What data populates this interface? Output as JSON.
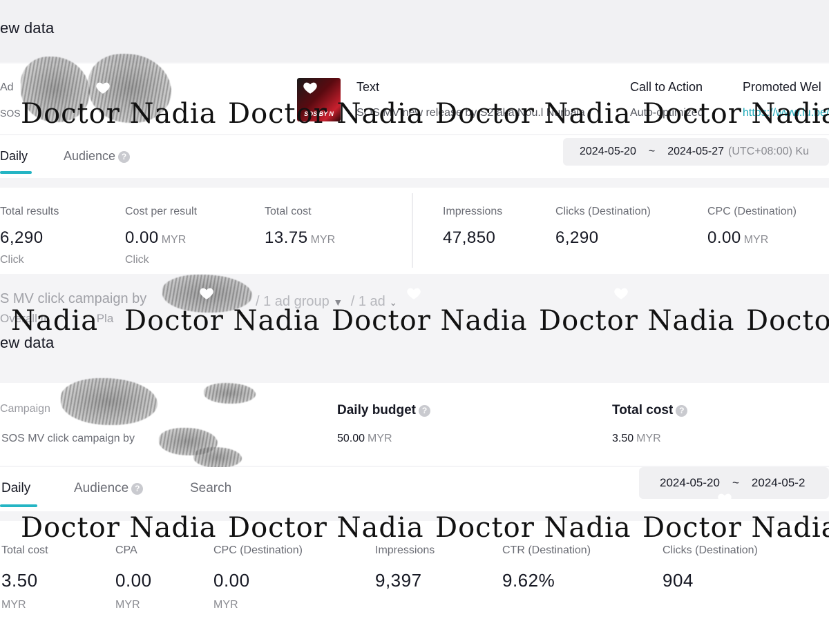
{
  "top": {
    "title": "ew data",
    "ad": {
      "label": "Ad",
      "name_preview": "SOS",
      "text_header": "Text",
      "text_value": "SOS MV new release by S2 aka Nou.l Nurbaia",
      "cta_header": "Call to Action",
      "cta_value": "Auto-optimized",
      "site_header": "Promoted Wel",
      "site_value": "https://www.lu.be/"
    },
    "thumbnail_text": "SOS BY N",
    "tabs": [
      "Daily",
      "Audience"
    ],
    "date_range": {
      "start": "2024-05-20",
      "sep": "~",
      "end": "2024-05-27",
      "tz": "(UTC+08:00) Ku"
    },
    "metrics": [
      {
        "label": "Total results",
        "value": "6,290",
        "unit": "",
        "sub": "Click"
      },
      {
        "label": "Cost per result",
        "value": "0.00",
        "unit": "MYR",
        "sub": "Click"
      },
      {
        "label": "Total cost",
        "value": "13.75",
        "unit": "MYR",
        "sub": ""
      },
      {
        "label": "Impressions",
        "value": "47,850",
        "unit": "",
        "sub": ""
      },
      {
        "label": "Clicks (Destination)",
        "value": "6,290",
        "unit": "",
        "sub": ""
      },
      {
        "label": "CPC (Destination)",
        "value": "0.00",
        "unit": "MYR",
        "sub": ""
      }
    ]
  },
  "breadcrumb": {
    "campaign": "S MV click campaign by",
    "ad_group": "/ 1 ad group",
    "ad": "/ 1 ad",
    "sub1": "Overall tr",
    "sub2": "Pla"
  },
  "bottom": {
    "title": "ew data",
    "campaign_label": "Campaign",
    "campaign_value": "SOS MV click campaign by",
    "budget_label": "Daily budget",
    "budget_value": "50.00",
    "budget_unit": "MYR",
    "cost_label": "Total cost",
    "cost_value": "3.50",
    "cost_unit": "MYR",
    "tabs": [
      "Daily",
      "Audience",
      "Search"
    ],
    "date_range": {
      "start": "2024-05-20",
      "sep": "~",
      "end": "2024-05-2"
    },
    "metrics": [
      {
        "label": "Total cost",
        "value": "3.50",
        "sub": "MYR"
      },
      {
        "label": "CPA",
        "value": "0.00",
        "sub": "MYR"
      },
      {
        "label": "CPC (Destination)",
        "value": "0.00",
        "sub": "MYR"
      },
      {
        "label": "Impressions",
        "value": "9,397",
        "sub": ""
      },
      {
        "label": "CTR (Destination)",
        "value": "9.62%",
        "sub": ""
      },
      {
        "label": "Clicks (Destination)",
        "value": "904",
        "sub": ""
      }
    ]
  },
  "watermark": {
    "text": "Doctor Nadia",
    "row2_first": "Nadia",
    "row2_last": "Doctor"
  },
  "colors": {
    "accent": "#25b5c4",
    "link": "#1aa8b8",
    "text": "#161823",
    "muted": "#6b6d75"
  }
}
